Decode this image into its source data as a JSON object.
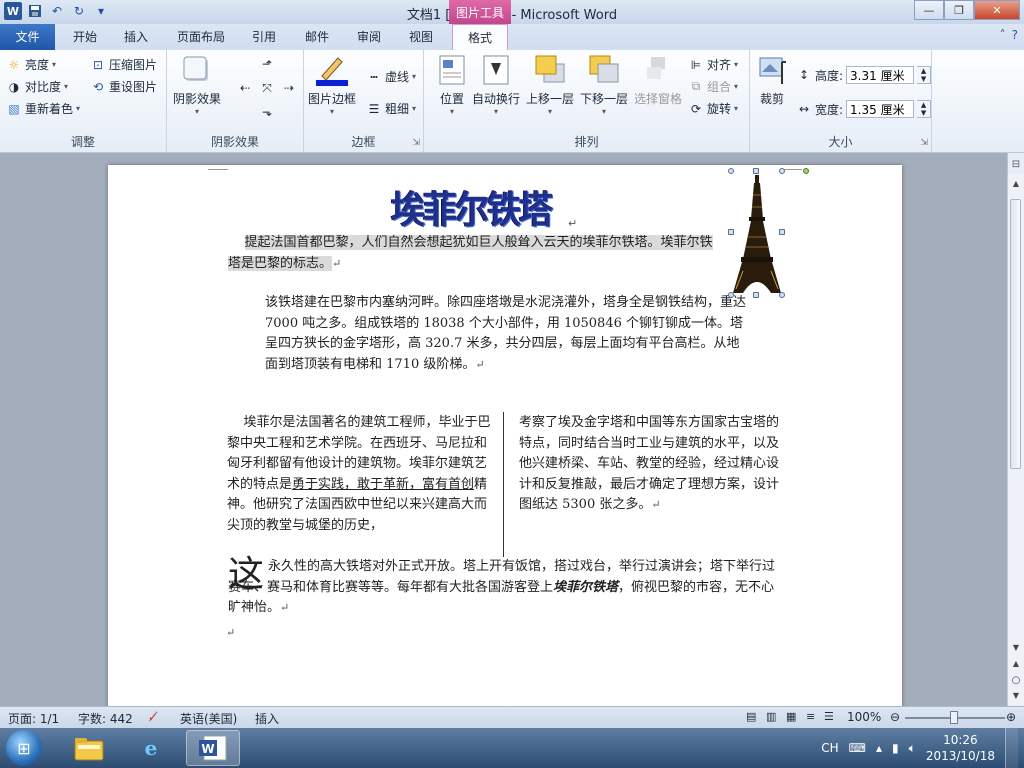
{
  "window": {
    "title": "文档1 [兼容模式] - Microsoft Word",
    "context_tab_header": "图片工具",
    "app_logo": "W"
  },
  "tabs": [
    "文件",
    "开始",
    "插入",
    "页面布局",
    "引用",
    "邮件",
    "审阅",
    "视图",
    "格式"
  ],
  "ribbon": {
    "adjust": {
      "brightness": "亮度",
      "contrast": "对比度",
      "recolor": "重新着色",
      "compress": "压缩图片",
      "reset": "重设图片",
      "label": "调整"
    },
    "shadow": {
      "shadow_effect": "阴影效果",
      "label": "阴影效果"
    },
    "border": {
      "picture_border": "图片边框",
      "dash": "虚线",
      "weight": "粗细",
      "label": "边框"
    },
    "arrange": {
      "position": "位置",
      "wrap": "自动换行",
      "bring_forward": "上移一层",
      "send_backward": "下移一层",
      "selection_pane": "选择窗格",
      "align": "对齐",
      "group": "组合",
      "rotate": "旋转",
      "label": "排列"
    },
    "size": {
      "crop": "裁剪",
      "height_label": "高度:",
      "height_value": "3.31 厘米",
      "width_label": "宽度:",
      "width_value": "1.35 厘米",
      "label": "大小"
    }
  },
  "document": {
    "wordart": "埃菲尔铁塔",
    "para_intro_highlighted": "提起法国首都巴黎，人们自然会想起犹如巨人般耸入云天的埃菲尔铁塔。埃菲尔铁塔是巴黎的标志。",
    "para_2": "该铁塔建在巴黎市内塞纳河畔。除四座塔墩是水泥浇灌外，塔身全是钢铁结构，重达 7000 吨之多。组成铁塔的 18038 个大小部件，用 1050846 个铆钉铆成一体。塔呈四方狭长的金字塔形，高 320.7 米多，共分四层，每层上面均有平台高栏。从地面到塔顶装有电梯和 1710 级阶梯。",
    "para_3_before": "埃菲尔是法国著名的建筑工程师，毕业于巴黎中央工程和艺术学院。在西班牙、马尼拉和匈牙利都留有他设计的建筑物。埃菲尔建筑艺术的特点是",
    "para_3_underline": "勇于实践，敢于革新，富有首创",
    "para_3_after": "精神。他研究了法国西欧中世纪以来兴建高大而尖顶的教堂与城堡的历史，",
    "para_3b": "考察了埃及金字塔和中国等东方国家古宝塔的特点，同时结合当时工业与建筑的水平，以及他兴建桥梁、车站、教堂的经验，经过精心设计和反复推敲，最后才确定了理想方案，设计图纸达 5300 张之多。",
    "dropcap": "这",
    "para_4_before": "永久性的高大铁塔对外正式开放。塔上开有饭馆，搭过戏台，举行过演讲会；塔下举行过赛车、赛马和体育比赛等等。每年都有大批各国游客登上",
    "para_4_bold": "埃菲尔铁塔",
    "para_4_after": "，俯视巴黎的市容，无不心旷神怡。",
    "pilcrow": "↵"
  },
  "status": {
    "page": "页面: 1/1",
    "words": "字数: 442",
    "language": "英语(美国)",
    "mode": "插入",
    "zoom": "100%"
  },
  "taskbar": {
    "ime": "CH",
    "time": "10:26",
    "date": "2013/10/18"
  },
  "icons": [
    "word-logo-icon",
    "save-icon",
    "undo-icon",
    "redo-icon",
    "customize-icon",
    "minimize-icon",
    "maximize-icon",
    "close-icon",
    "help-icon",
    "brightness-icon",
    "contrast-icon",
    "recolor-icon",
    "compress-icon",
    "reset-picture-icon",
    "shadow-icon",
    "picture-border-icon",
    "position-icon",
    "wrap-icon",
    "crop-icon",
    "eiffel-tower-image",
    "start-icon",
    "explorer-icon",
    "ie-icon",
    "word-taskbar-icon",
    "volume-icon"
  ],
  "colors": {
    "file_tab": "#2b579a",
    "context_tab": "#c2478d",
    "wordart": "#1f2f8a"
  }
}
